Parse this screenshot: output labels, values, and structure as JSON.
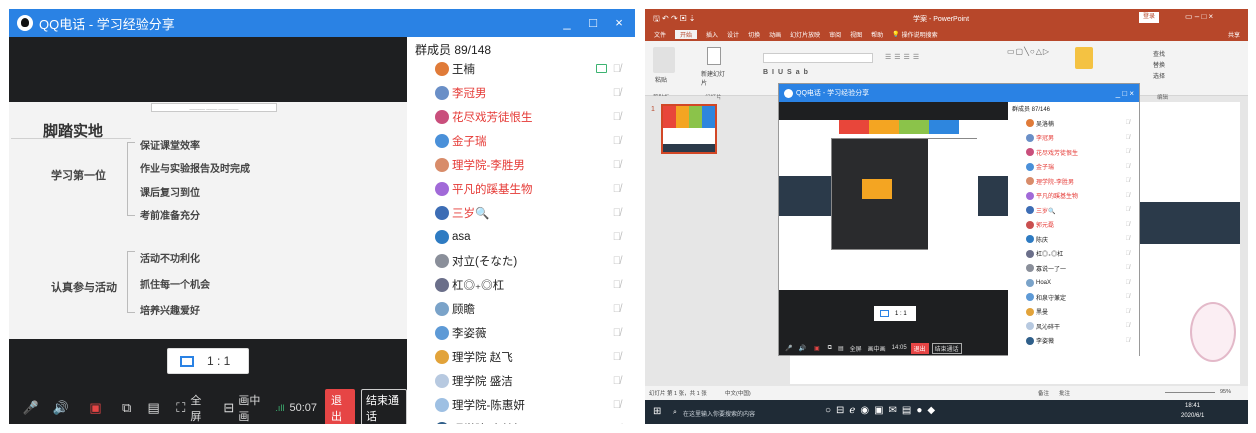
{
  "left_window": {
    "title": "QQ电话 - 学习经验分享",
    "minimize": "_",
    "maximize": "□",
    "close": "×",
    "slide": {
      "header_text": "_______  _____  _________",
      "heading": "脚踏实地",
      "node1": "学习第一位",
      "items1": [
        "保证课堂效率",
        "作业与实验报告及时完成",
        "课后复习到位",
        "考前准备充分"
      ],
      "node2": "认真参与活动",
      "items2": [
        "活动不功利化",
        "抓住每一个机会",
        "培养兴趣爱好"
      ]
    },
    "ratio": "1 : 1",
    "controls": {
      "fullscreen": "全屏",
      "pip": "画中画",
      "duration": "50:07",
      "exit": "退出",
      "end_call": "结束通话"
    },
    "members": {
      "header": "群成员 89/148",
      "list": [
        {
          "name": "王楠",
          "color": "blk",
          "avatar": "#e07b39"
        },
        {
          "name": "李冠男",
          "color": "red",
          "avatar": "#6a8fc7"
        },
        {
          "name": "花尽戏芳徒恨生",
          "color": "red",
          "avatar": "#c94f7c"
        },
        {
          "name": "金子瑞",
          "color": "red",
          "avatar": "#4a90d9"
        },
        {
          "name": "理学院-李胜男",
          "color": "red",
          "avatar": "#d88c6a"
        },
        {
          "name": "平凡的蹊基生物",
          "color": "red",
          "avatar": "#a16ad8"
        },
        {
          "name": "三岁🔍",
          "color": "red",
          "avatar": "#3d6db5"
        },
        {
          "name": "asa",
          "color": "blk",
          "avatar": "#2e7bc2"
        },
        {
          "name": "对立(そなた)",
          "color": "blk",
          "avatar": "#8a8f9a"
        },
        {
          "name": "杠◎₊◎杠",
          "color": "blk",
          "avatar": "#6b6f8a"
        },
        {
          "name": "顾瞻",
          "color": "blk",
          "avatar": "#7aa3c9"
        },
        {
          "name": "李姿薇",
          "color": "blk",
          "avatar": "#5e9ad6"
        },
        {
          "name": "理学院 赵飞",
          "color": "blk",
          "avatar": "#e2a33a"
        },
        {
          "name": "理学院 盛洁",
          "color": "blk",
          "avatar": "#b7c9e0"
        },
        {
          "name": "理学院-陈惠妍",
          "color": "blk",
          "avatar": "#9ec0e3"
        },
        {
          "name": "理学院-李懿恒",
          "color": "blk",
          "avatar": "#2f5f8a"
        }
      ]
    }
  },
  "right_window": {
    "title": "学案 - PowerPoint",
    "menu": [
      "文件",
      "开始",
      "插入",
      "设计",
      "切换",
      "动画",
      "幻灯片放映",
      "审阅",
      "视图",
      "帮助",
      "操作说明搜索"
    ],
    "share": "共享",
    "ribbon_groups": [
      "剪贴板",
      "幻灯片",
      "字体",
      "段落",
      "绘图",
      "编辑"
    ],
    "ribbon_buttons": {
      "paste": "粘贴",
      "new_slide": "新建幻灯片",
      "find": "查找",
      "replace": "替换",
      "select": "选择"
    },
    "slide_number": "1",
    "status_left": "幻灯片 第 1 张，共 1 张",
    "status_lang": "中文(中国)",
    "status_notes": "备注",
    "status_comments": "批注",
    "zoom": "95%",
    "taskbar_search": "在这里输入你要搜索的内容",
    "taskbar_time": "18:41",
    "taskbar_date": "2020/6/1",
    "nested_qq": {
      "title": "QQ电话 - 学习经验分享",
      "header": "群成员 87/146",
      "ratio": "1 : 1",
      "fullscreen": "全屏",
      "pip": "画中画",
      "duration": "14:05",
      "exit": "退出",
      "end_call": "结束通话",
      "list": [
        {
          "name": "吴洛楠",
          "color": "blk",
          "avatar": "#e07b39"
        },
        {
          "name": "李冠男",
          "color": "red",
          "avatar": "#6a8fc7"
        },
        {
          "name": "花尽戏芳徒恨生",
          "color": "red",
          "avatar": "#c94f7c"
        },
        {
          "name": "金子瑞",
          "color": "red",
          "avatar": "#4a90d9"
        },
        {
          "name": "理学院-李胜男",
          "color": "red",
          "avatar": "#d88c6a"
        },
        {
          "name": "平凡的蹊基生物",
          "color": "red",
          "avatar": "#a16ad8"
        },
        {
          "name": "三岁🔍",
          "color": "red",
          "avatar": "#3d6db5"
        },
        {
          "name": "郭元磊",
          "color": "red",
          "avatar": "#c94f4f"
        },
        {
          "name": "陈庆",
          "color": "blk",
          "avatar": "#2e7bc2"
        },
        {
          "name": "杠◎₊◎杠",
          "color": "blk",
          "avatar": "#6b6f8a"
        },
        {
          "name": "寡说一了一",
          "color": "blk",
          "avatar": "#8a8f9a"
        },
        {
          "name": "HoaX",
          "color": "blk",
          "avatar": "#7aa3c9"
        },
        {
          "name": "和泉守兼定",
          "color": "blk",
          "avatar": "#5e9ad6"
        },
        {
          "name": "黑曼",
          "color": "blk",
          "avatar": "#e2a33a"
        },
        {
          "name": "风沁碎干",
          "color": "blk",
          "avatar": "#b7c9e0"
        },
        {
          "name": "李姿薇",
          "color": "blk",
          "avatar": "#2f5f8a"
        }
      ]
    }
  },
  "colors": {
    "qq_blue": "#2a82e4",
    "ppt_red": "#b7472a",
    "exit_red": "#e64545"
  }
}
